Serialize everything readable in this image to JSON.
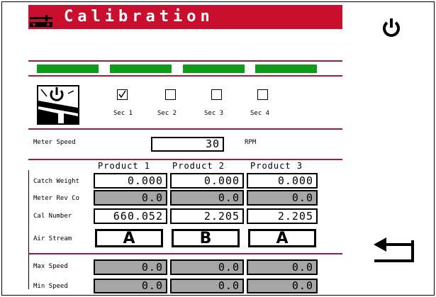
{
  "header": {
    "title": "Calibration",
    "logo_icon": "planter-logo-icon",
    "power_icon": "power-icon"
  },
  "colors": {
    "header_bg": "#c8102e",
    "status_bar": "#0e9b1a",
    "divider": "#9b1d3c",
    "gray_field": "#a6a6a6"
  },
  "status_bars": [
    {
      "state": "on"
    },
    {
      "state": "on"
    },
    {
      "state": "on"
    },
    {
      "state": "on"
    }
  ],
  "sections": [
    {
      "label": "Sec 1",
      "checked": true
    },
    {
      "label": "Sec 2",
      "checked": false
    },
    {
      "label": "Sec 3",
      "checked": false
    },
    {
      "label": "Sec 4",
      "checked": false
    }
  ],
  "meter_speed": {
    "label": "Meter Speed",
    "value": "30",
    "unit": "RPM"
  },
  "products": [
    "Product 1",
    "Product 2",
    "Product 3"
  ],
  "rows": {
    "catch_weight": {
      "label": "Catch Weight",
      "values": [
        "0.000",
        "0.000",
        "0.000"
      ]
    },
    "meter_rev": {
      "label": "Meter Rev Co",
      "values": [
        "0.0",
        "0.0",
        "0.0"
      ]
    },
    "cal_number": {
      "label": "Cal Number",
      "values": [
        "660.052",
        "2.205",
        "2.205"
      ]
    },
    "air_stream": {
      "label": "Air Stream",
      "values": [
        "A",
        "B",
        "A"
      ]
    },
    "max_speed": {
      "label": "Max Speed",
      "values": [
        "0.0",
        "0.0",
        "0.0"
      ]
    },
    "min_speed": {
      "label": "Min Speed",
      "values": [
        "0.0",
        "0.0",
        "0.0"
      ]
    }
  },
  "back_icon": "return-arrow-icon"
}
